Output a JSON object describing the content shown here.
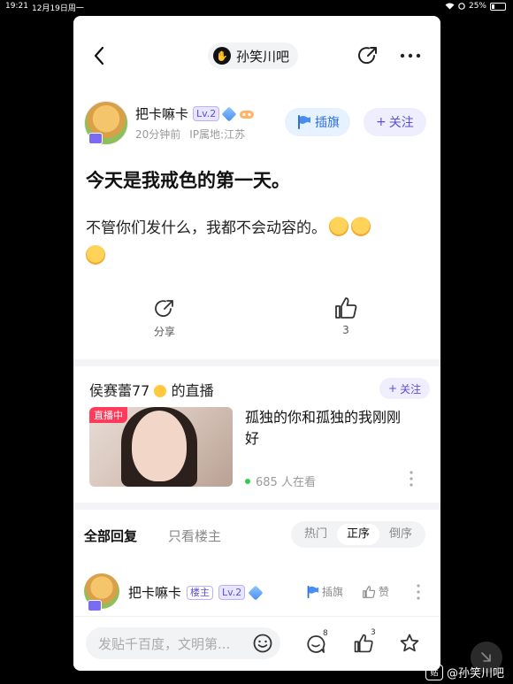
{
  "status_bar": {
    "time": "19:21",
    "date": "12月19日周一",
    "battery": "25%"
  },
  "nav": {
    "forum_name": "孙笑川吧",
    "forum_avatar_char": "✋"
  },
  "author": {
    "name": "把卡嘛卡",
    "level": "Lv.2",
    "time_ago": "20分钟前",
    "ip_location": "IP属地:江苏",
    "flag_label": "插旗",
    "follow_label": "关注"
  },
  "post": {
    "title": "今天是我戒色的第一天。",
    "body": "不管你们发什么，我都不会动容的。"
  },
  "actions": {
    "share_label": "分享",
    "like_count": "3"
  },
  "live": {
    "streamer": "侯赛蕾77",
    "suffix": "的直播",
    "follow_label": "关注",
    "tag": "直播中",
    "description": "孤独的你和孤独的我刚刚好",
    "viewers": "685 人在看"
  },
  "replies": {
    "tab_all": "全部回复",
    "tab_owner": "只看楼主",
    "sort_options": [
      "热门",
      "正序",
      "倒序"
    ],
    "sort_selected": "正序",
    "first_reply": {
      "name": "把卡嘛卡",
      "owner_tag": "楼主",
      "level": "Lv.2",
      "flag_label": "插旗",
      "like_label": "赞"
    }
  },
  "bottom_bar": {
    "input_placeholder": "发贴千百度，文明第...",
    "comment_count": "8",
    "like_count": "3"
  },
  "watermark": {
    "logo": "贴",
    "text": "@孙笑川吧"
  },
  "colors": {
    "accent": "#5b4fd8",
    "flag": "#2e6fe0",
    "live_tag": "#ff3b5c"
  }
}
